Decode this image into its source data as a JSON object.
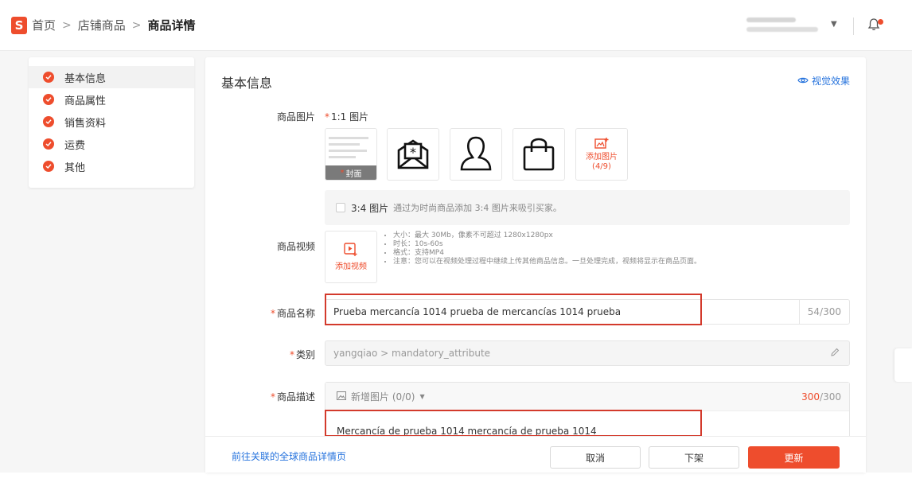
{
  "header": {
    "logo_letter": "S",
    "breadcrumb": [
      "首页",
      "店铺商品",
      "商品详情"
    ],
    "separator": ">"
  },
  "nav": {
    "items": [
      {
        "label": "基本信息",
        "active": true
      },
      {
        "label": "商品属性",
        "active": false
      },
      {
        "label": "销售资料",
        "active": false
      },
      {
        "label": "运费",
        "active": false
      },
      {
        "label": "其他",
        "active": false
      }
    ]
  },
  "main": {
    "section_title": "基本信息",
    "preview_label": "视觉效果",
    "product_images": {
      "label": "商品图片",
      "sub_label": "1:1 图片",
      "cover_badge": "封面",
      "add_image_label": "添加图片",
      "add_image_count": "(4/9)"
    },
    "ratio_option": {
      "title": "3:4 图片",
      "description": "通过为时尚商品添加 3:4 图片来吸引买家。"
    },
    "product_video": {
      "label": "商品视频",
      "add_video_label": "添加视频",
      "rules": [
        "大小：最大 30Mb，像素不可超过 1280x1280px",
        "时长：10s-60s",
        "格式：支持MP4",
        "注意：您可以在视频处理过程中继续上传其他商品信息。一旦处理完成，视频将显示在商品页面。"
      ]
    },
    "product_name": {
      "label": "商品名称",
      "value": "Prueba mercancía 1014 prueba de mercancías 1014 prueba",
      "count": "54/300"
    },
    "category": {
      "label": "类别",
      "value": "yangqiao > mandatory_attribute"
    },
    "description": {
      "label": "商品描述",
      "add_image_label": "新增图片 (0/0)",
      "count_used": "300",
      "count_total": "/300",
      "text": "Mercancía de prueba 1014 mercancía de prueba 1014"
    }
  },
  "footer": {
    "global_link": "前往关联的全球商品详情页",
    "cancel_label": "取消",
    "delist_label": "下架",
    "update_label": "更新"
  },
  "colors": {
    "brand": "#ee4d2d",
    "link": "#2673dd",
    "highlight_box": "#d33a2c"
  }
}
